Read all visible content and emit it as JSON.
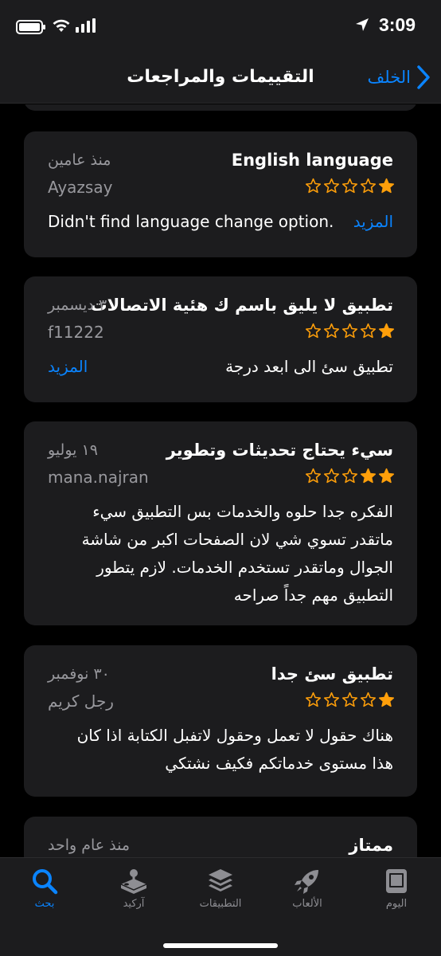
{
  "status": {
    "time": "3:09"
  },
  "nav": {
    "title": "التقييمات والمراجعات",
    "back_label": "الخلف"
  },
  "colors": {
    "accent": "#0a84ff",
    "star": "#ff9f0a",
    "card": "#1c1c1e",
    "secondary_text": "#98989d"
  },
  "reviews": [
    {
      "title": "English language",
      "date": "منذ عامين",
      "user": "Ayazsay",
      "rating": 1,
      "body": "Didn't find language change option.",
      "more": "المزيد"
    },
    {
      "title": "تطبيق لا يليق باسم ك هئية الاتصالات",
      "date": "٣ ديسمبر",
      "user": "f11222",
      "rating": 1,
      "body": "تطبيق سئ الى ابعد درجة",
      "more": "المزيد"
    },
    {
      "title": "سيء يحتاج تحديثات وتطوير",
      "date": "١٩ يوليو",
      "user": "mana.najran",
      "rating": 2,
      "body": "الفكره جدا حلوه والخدمات بس التطبيق سيء ماتقدر تسوي شي لان الصفحات اكبر من شاشة الجوال وماتقدر تستخدم الخدمات. لازم يتطور التطبيق مهم جداً صراحه"
    },
    {
      "title": "تطبيق سئ جدا",
      "date": "٣٠ نوفمبر",
      "user": "رجل كريم",
      "rating": 1,
      "body": "هناك حقول لا تعمل وحقول لاتفبل الكتابة اذا كان هذا مستوى خدماتكم فكيف نشتكي"
    },
    {
      "title": "ممتاز",
      "date": "منذ عام واحد"
    }
  ],
  "tabs": [
    {
      "label": "اليوم",
      "icon": "today-icon"
    },
    {
      "label": "الألعاب",
      "icon": "rocket-icon"
    },
    {
      "label": "التطبيقات",
      "icon": "apps-stack-icon"
    },
    {
      "label": "آركيد",
      "icon": "arcade-joystick-icon"
    },
    {
      "label": "بحث",
      "icon": "search-icon",
      "active": true
    }
  ]
}
